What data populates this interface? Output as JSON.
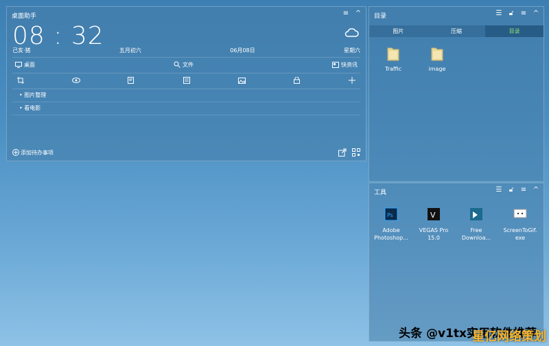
{
  "assistant": {
    "title": "桌面助手",
    "time": "08 : 32",
    "dates": [
      "己亥·猪",
      "五月初六",
      "06月08日",
      "星期六"
    ],
    "nav": [
      "桌面",
      "文件",
      "快资讯"
    ],
    "todos": [
      "图片整理",
      "看电影"
    ],
    "add_todo": "添加待办事项"
  },
  "directory": {
    "title": "目录",
    "tabs": [
      "图片",
      "压缩",
      "目录"
    ],
    "items": [
      "Traffic",
      "image"
    ]
  },
  "tools": {
    "title": "工具",
    "items": [
      {
        "l1": "Adobe",
        "l2": "Photoshop..."
      },
      {
        "l1": "VEGAS Pro",
        "l2": "15.0"
      },
      {
        "l1": "Free",
        "l2": "Downloa..."
      },
      {
        "l1": "ScreenToGif.",
        "l2": "exe"
      }
    ]
  },
  "watermark": "头条 @v1tx实用软件推荐",
  "watermark2": "星亿网络策划"
}
